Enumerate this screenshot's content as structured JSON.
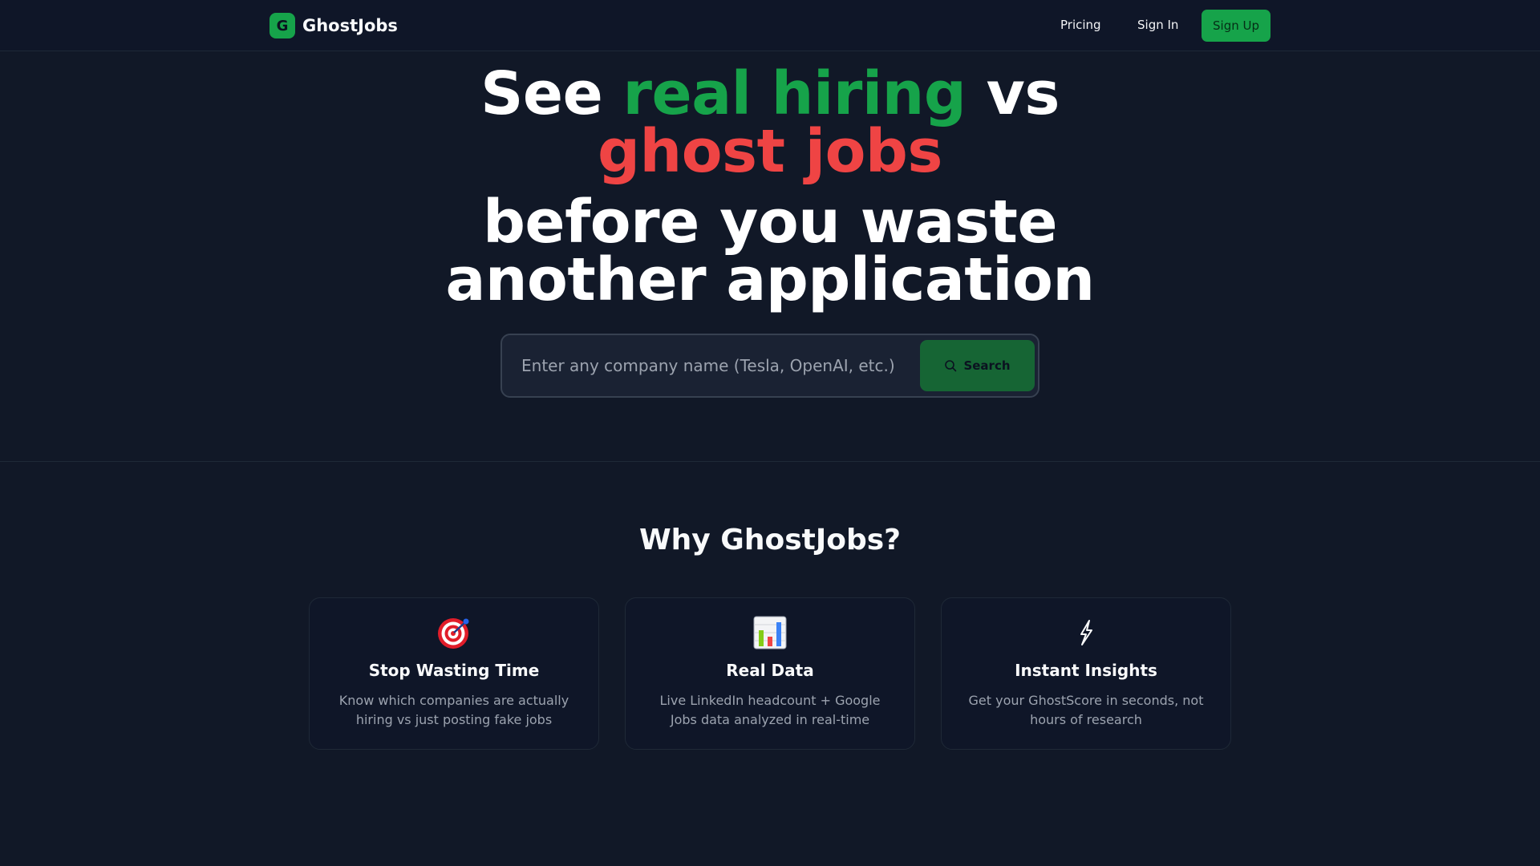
{
  "nav": {
    "brand_initial": "G",
    "brand_name": "GhostJobs",
    "links": [
      "Pricing",
      "Sign In"
    ],
    "signup_label": "Sign Up"
  },
  "hero": {
    "line1_prefix": "See ",
    "line1_highlight": "real hiring",
    "line1_suffix": " vs",
    "line2": "ghost jobs",
    "line3": "before you waste",
    "line4": "another application",
    "search_placeholder": "Enter any company name (Tesla, OpenAI, etc.)",
    "search_button": "Search"
  },
  "features": {
    "title": "Why GhostJobs?",
    "cards": [
      {
        "icon": "target-icon",
        "title": "Stop Wasting Time",
        "description": "Know which companies are actually hiring vs just posting fake jobs"
      },
      {
        "icon": "bar-chart-icon",
        "title": "Real Data",
        "description": "Live LinkedIn headcount + Google Jobs data analyzed in real-time"
      },
      {
        "icon": "lightning-icon",
        "title": "Instant Insights",
        "description": "Get your GhostScore in seconds, not hours of research"
      }
    ]
  },
  "colors": {
    "background": "#111827",
    "accent_green": "#16a34a",
    "accent_red": "#ef4444"
  }
}
